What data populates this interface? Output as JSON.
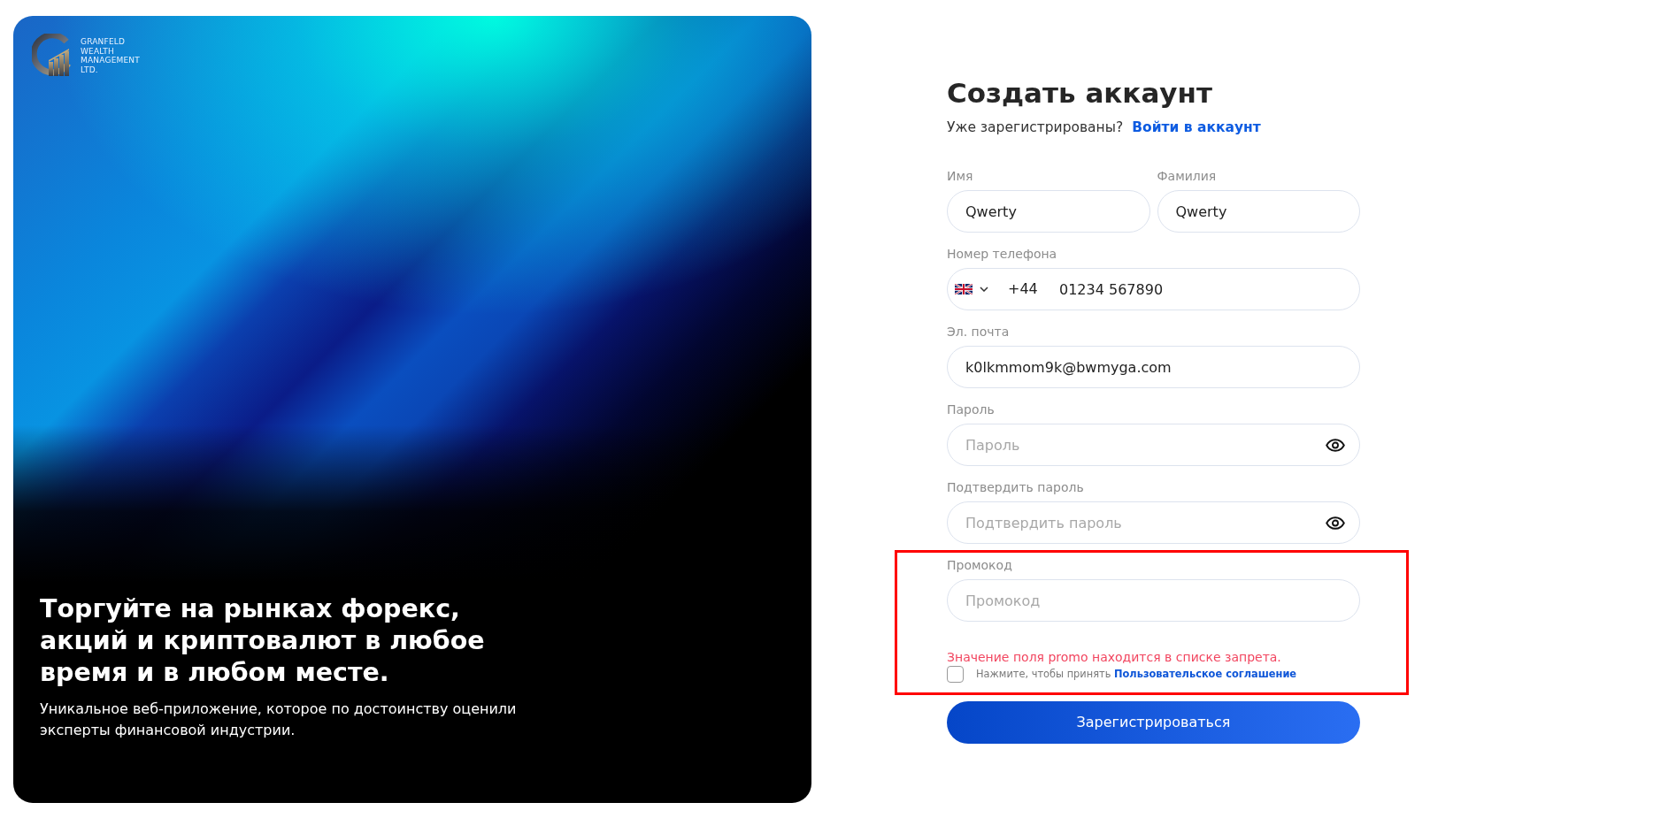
{
  "hero": {
    "logo_lines": [
      "GRANFELD",
      "WEALTH",
      "MANAGEMENT",
      "LTD."
    ],
    "headline_lines": [
      "Торгуйте на рынках форекс,",
      "акций и криптовалют в любое",
      "время и в любом месте."
    ],
    "subtext_lines": [
      "Уникальное веб-приложение, которое по достоинству оценили",
      "эксперты финансовой индустрии."
    ]
  },
  "form": {
    "title": "Создать аккаунт",
    "login_prompt": "Уже зарегистрированы?",
    "login_link": "Войти в аккаунт",
    "name_fields": [
      {
        "label": "Имя",
        "value": "Qwerty"
      },
      {
        "label": "Фамилия",
        "value": "Qwerty"
      }
    ],
    "phone": {
      "label": "Номер телефона",
      "country_code": "+44",
      "value": "01234 567890"
    },
    "email": {
      "label": "Эл. почта",
      "value": "k0lkmmom9k@bwmyga.com"
    },
    "passwords": [
      {
        "label": "Пароль",
        "placeholder": "Пароль"
      },
      {
        "label": "Подтвердить пароль",
        "placeholder": "Подтвердить пароль"
      }
    ],
    "promo": {
      "label": "Промокод",
      "placeholder": "Промокод",
      "highlighted": true
    },
    "error": "Значение поля promo находится в списке запрета.",
    "agreement": {
      "checked": false,
      "text": "Нажмите, чтобы принять",
      "link": "Пользовательское соглашение"
    },
    "submit": "Зарегистрироваться"
  }
}
